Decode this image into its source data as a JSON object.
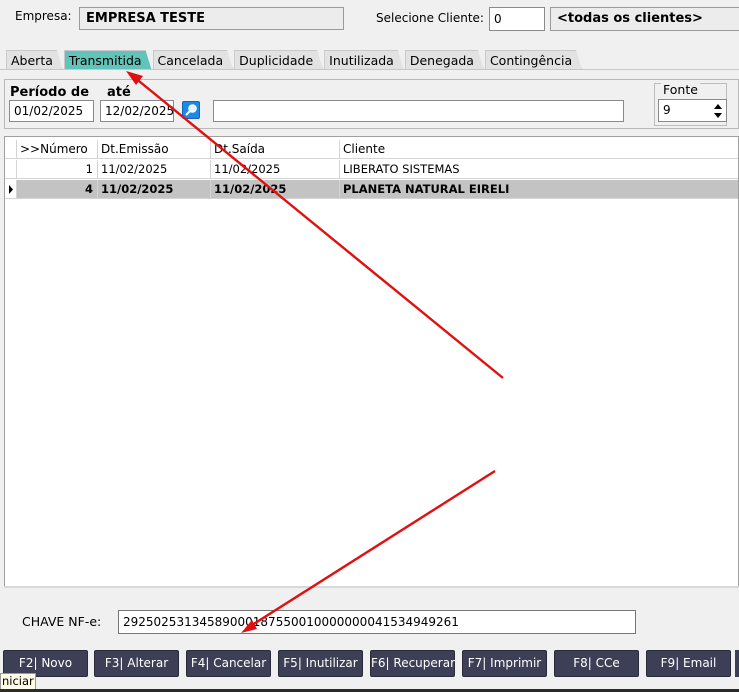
{
  "header": {
    "empresa_label": "Empresa:",
    "empresa_value": "EMPRESA TESTE",
    "cliente_label": "Selecione Cliente:",
    "cliente_code": "0",
    "cliente_value": "<todas os clientes>"
  },
  "tabs": [
    {
      "label": "Aberta"
    },
    {
      "label": "Transmitida"
    },
    {
      "label": "Cancelada"
    },
    {
      "label": "Duplicidade"
    },
    {
      "label": "Inutilizada"
    },
    {
      "label": "Denegada"
    },
    {
      "label": "Contingência"
    }
  ],
  "active_tab": "Transmitida",
  "filter": {
    "periodo_label": "Período de",
    "ate_label": "até",
    "date_from": "01/02/2025",
    "date_to": "12/02/2025",
    "search_text": "",
    "fonte_label": "Fonte",
    "fonte_value": "9"
  },
  "grid": {
    "columns": [
      ">>Número",
      "Dt.Emissão",
      "Dt.Saída",
      "Cliente"
    ],
    "rows": [
      {
        "numero": "1",
        "emissao": "11/02/2025",
        "saida": "11/02/2025",
        "cliente": "LIBERATO SISTEMAS"
      },
      {
        "numero": "4",
        "emissao": "11/02/2025",
        "saida": "11/02/2025",
        "cliente": "PLANETA NATURAL EIRELI"
      }
    ]
  },
  "chave": {
    "label": "CHAVE NF-e:",
    "value": "29250253134589000187550010000000041534949261"
  },
  "buttons": [
    {
      "label": "F2| Novo"
    },
    {
      "label": "F3| Alterar"
    },
    {
      "label": "F4| Cancelar"
    },
    {
      "label": "F5| Inutilizar"
    },
    {
      "label": "F6| Recuperar"
    },
    {
      "label": "F7| Imprimir"
    },
    {
      "label": "F8| CCe"
    },
    {
      "label": "F9| Email"
    }
  ],
  "status_tooltip": "niciar",
  "colors": {
    "active_tab": "#62c3bb",
    "button_bg": "#3d3f56",
    "selected_row": "#c3c3c3",
    "annotation_arrow": "#e01010"
  }
}
